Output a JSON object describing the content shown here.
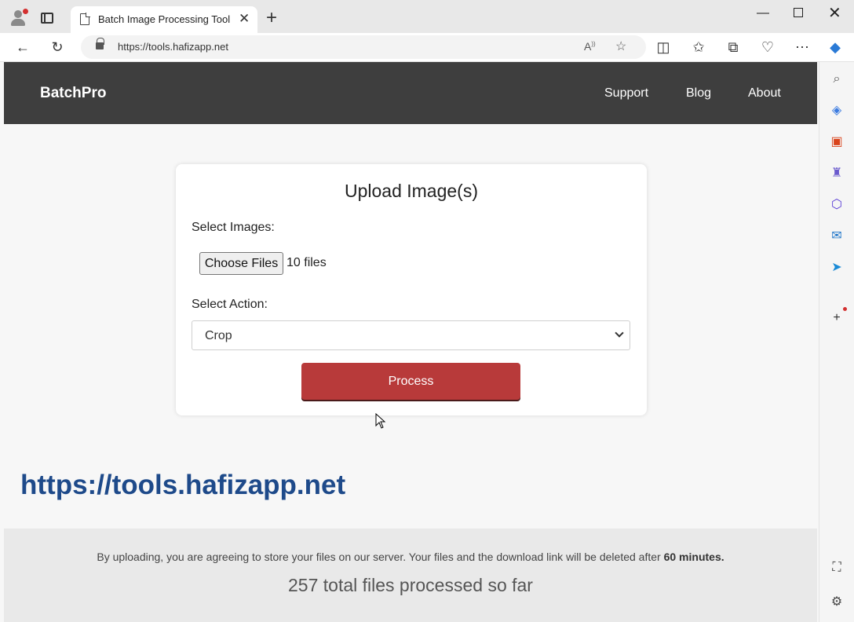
{
  "browser": {
    "tab_title": "Batch Image Processing Tool",
    "tab_close": "✕",
    "new_tab": "+",
    "url": "https://tools.hafizapp.net"
  },
  "site": {
    "brand": "BatchPro",
    "nav": [
      "Support",
      "Blog",
      "About"
    ]
  },
  "upload": {
    "title": "Upload Image(s)",
    "select_images_label": "Select Images:",
    "choose_files_label": "Choose Files",
    "file_count": "10 files",
    "select_action_label": "Select Action:",
    "selected_action": "Crop",
    "process_label": "Process"
  },
  "banner_url": "https://tools.hafizapp.net",
  "footer": {
    "notice": "By uploading, you are agreeing to store your files on our server. Your files and the download link will be deleted after ",
    "notice_bold": "60 minutes.",
    "counter": "257 total files processed so far"
  },
  "colors": {
    "navbar": "#3e3e3e",
    "process_button": "#b83a3a",
    "banner_url": "#1e4a8a"
  }
}
